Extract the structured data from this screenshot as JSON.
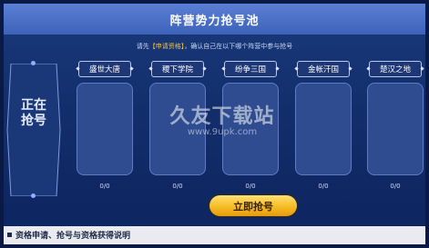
{
  "header": {
    "title": "阵营势力抢号池"
  },
  "notice": {
    "prefix": "请先",
    "highlight": "【申请资格】",
    "suffix": "，确认自己在以下哪个阵营中参与抢号"
  },
  "side_label": "正在抢号",
  "camps": [
    {
      "name": "盛世大唐",
      "count": "0/0"
    },
    {
      "name": "稷下学院",
      "count": "0/0"
    },
    {
      "name": "纷争三国",
      "count": "0/0"
    },
    {
      "name": "金帐汗国",
      "count": "0/0"
    },
    {
      "name": "楚汉之地",
      "count": "0/0"
    }
  ],
  "actions": {
    "grab_label": "立即抢号"
  },
  "bottom": {
    "title": "资格申请、抢号与资格获得说明"
  },
  "watermark": {
    "big": "久友下载站",
    "small": "www.9upk.com"
  },
  "colors": {
    "accent": "#f5b820",
    "background": "#122e6a",
    "title_bar": "#4a6fc6"
  }
}
